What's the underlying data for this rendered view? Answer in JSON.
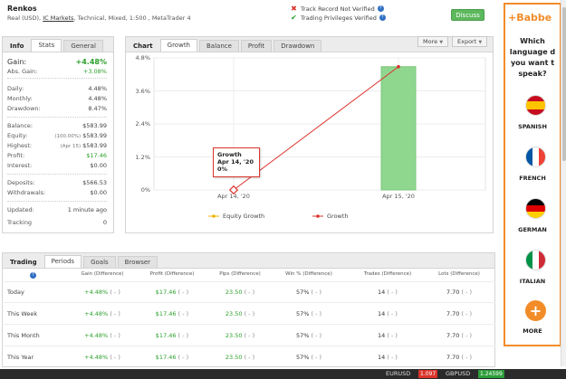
{
  "header": {
    "title": "Renkos",
    "sub_prefix": "Real (USD),",
    "sub_link": "IC Markets",
    "sub_suffix": ", Technical, Mixed, 1:500 , MetaTrader 4",
    "track_record": "Track Record Not Verified",
    "trading_privileges": "Trading Privileges Verified",
    "discuss_label": "Discuss",
    "colors": {
      "discuss": "#5cb85c",
      "verified": "#2ca02c",
      "not_verified": "#d9342b"
    }
  },
  "info": {
    "tabs": [
      "Info",
      "Stats",
      "General"
    ],
    "gain_label": "Gain:",
    "gain_value": "+4.48%",
    "abs_gain_label": "Abs. Gain:",
    "abs_gain_value": "+3.08%",
    "daily_label": "Daily:",
    "daily_value": "4.48%",
    "monthly_label": "Monthly:",
    "monthly_value": "4.48%",
    "drawdown_label": "Drawdown:",
    "drawdown_value": "8.47%",
    "balance_label": "Balance:",
    "balance_value": "$583.99",
    "equity_label": "Equity:",
    "equity_pre": "(100.00%)",
    "equity_value": "$583.99",
    "highest_label": "Highest:",
    "highest_pre": "(Apr 15)",
    "highest_value": "$583.99",
    "profit_label": "Profit:",
    "profit_value": "$17.46",
    "interest_label": "Interest:",
    "interest_value": "$0.00",
    "deposits_label": "Deposits:",
    "deposits_value": "$566.53",
    "withdrawals_label": "Withdrawals:",
    "withdrawals_value": "$0.00",
    "updated_label": "Updated:",
    "updated_value": "1 minute ago",
    "tracking_label": "Tracking",
    "tracking_value": "0"
  },
  "chart_panel": {
    "tabs": [
      "Chart",
      "Growth",
      "Balance",
      "Profit",
      "Drawdown"
    ],
    "more_label": "More",
    "export_label": "Export",
    "tooltip_title": "Growth",
    "tooltip_date": "Apr 14, '20",
    "tooltip_value": "0%",
    "legend": [
      "Equity Growth",
      "Growth"
    ]
  },
  "chart_data": {
    "type": "bar",
    "categories": [
      "Apr 14, '20",
      "Apr 15, '20"
    ],
    "series": [
      {
        "name": "Growth",
        "kind": "line",
        "values": [
          0,
          4.48
        ],
        "color": "#d9342b"
      },
      {
        "name": "Equity Growth",
        "kind": "line",
        "values": [
          null,
          null
        ],
        "color": "#f0b400"
      },
      {
        "name": "Growth",
        "kind": "bar",
        "values": [
          0,
          4.48
        ],
        "color": "#8fd68f"
      }
    ],
    "yticks": [
      "0%",
      "1.2%",
      "2.4%",
      "3.6%",
      "4.8%"
    ],
    "ylim": [
      0,
      4.8
    ],
    "grid": true,
    "legend_position": "bottom"
  },
  "trading": {
    "tabs": [
      "Trading",
      "Periods",
      "Goals",
      "Browser"
    ],
    "columns": [
      "Gain (Difference)",
      "Profit (Difference)",
      "Pips (Difference)",
      "Win % (Difference)",
      "Trades (Difference)",
      "Lots (Difference)"
    ],
    "rows": [
      {
        "period": "Today",
        "gain": "+4.48%",
        "profit": "$17.46",
        "pips": "23.50",
        "win": "57%",
        "trades": "14",
        "lots": "7.70",
        "diff": "( - )"
      },
      {
        "period": "This Week",
        "gain": "+4.48%",
        "profit": "$17.46",
        "pips": "23.50",
        "win": "57%",
        "trades": "14",
        "lots": "7.70",
        "diff": "( - )"
      },
      {
        "period": "This Month",
        "gain": "+4.48%",
        "profit": "$17.46",
        "pips": "23.50",
        "win": "57%",
        "trades": "14",
        "lots": "7.70",
        "diff": "( - )"
      },
      {
        "period": "This Year",
        "gain": "+4.48%",
        "profit": "$17.46",
        "pips": "23.50",
        "win": "57%",
        "trades": "14",
        "lots": "7.70",
        "diff": "( - )"
      }
    ]
  },
  "ad": {
    "brand": "+Babbe",
    "headline": [
      "Which",
      "language d",
      "you want t",
      "speak?"
    ],
    "languages": [
      "SPANISH",
      "FRENCH",
      "GERMAN",
      "ITALIAN"
    ],
    "more_label": "MORE",
    "brand_color": "#f28c28"
  },
  "bottom_bar": {
    "eurusd": "EURUSD",
    "eurusd_value": "1.097",
    "gbpusd": "GBPUSD",
    "gbpusd_value": "1.24599"
  }
}
